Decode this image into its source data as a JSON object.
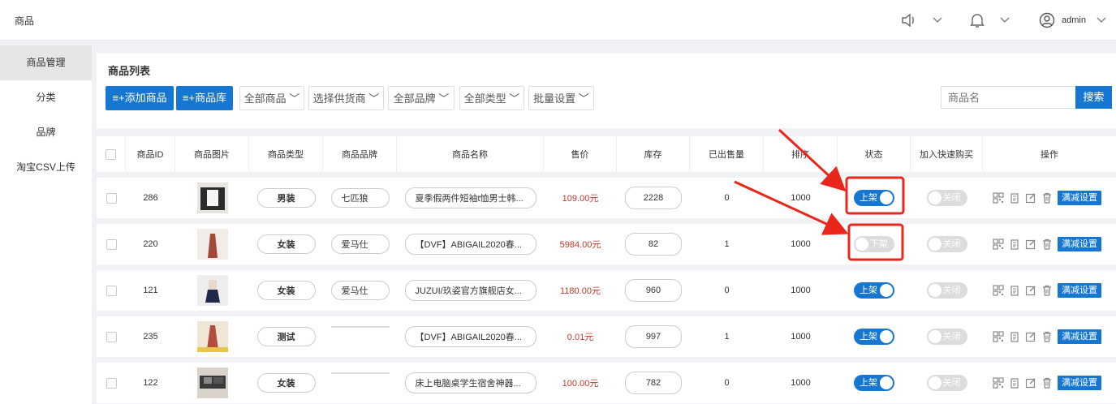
{
  "header": {
    "title": "商品",
    "user": "admin"
  },
  "sidebar": {
    "items": [
      {
        "label": "商品管理",
        "active": true
      },
      {
        "label": "分类"
      },
      {
        "label": "品牌"
      },
      {
        "label": "淘宝CSV上传"
      }
    ]
  },
  "toolbar": {
    "title": "商品列表",
    "add_button": "添加商品",
    "library_button": "商品库",
    "filters": [
      "全部商品",
      "选择供货商",
      "全部品牌",
      "全部类型",
      "批量设置"
    ],
    "search_placeholder": "商品名",
    "search_button": "搜索"
  },
  "table": {
    "headers": [
      "商品ID",
      "商品图片",
      "商品类型",
      "商品品牌",
      "商品名称",
      "售价",
      "库存",
      "已出售量",
      "排序",
      "状态",
      "加入快速购买",
      "操作"
    ],
    "rows": [
      {
        "id": "286",
        "type": "男装",
        "brand": "七匹狼",
        "name": "夏季假两件短袖t恤男士韩...",
        "price": "109.00元",
        "stock": "2228",
        "sold": "0",
        "sort": "1000",
        "status": "上架",
        "status_on": true,
        "quick": "关闭",
        "action": "满减设置",
        "thumb": "dark"
      },
      {
        "id": "220",
        "type": "女装",
        "brand": "爱马仕",
        "name": "【DVF】ABIGAIL2020春...",
        "price": "5984.00元",
        "stock": "82",
        "sold": "1",
        "sort": "1000",
        "status": "下架",
        "status_on": false,
        "quick": "关闭",
        "action": "满减设置",
        "thumb": "dress"
      },
      {
        "id": "121",
        "type": "女装",
        "brand": "爱马仕",
        "name": "JUZUI/玖姿官方旗舰店女...",
        "price": "1180.00元",
        "stock": "960",
        "sold": "0",
        "sort": "1000",
        "status": "上架",
        "status_on": true,
        "quick": "关闭",
        "action": "满减设置",
        "thumb": "skirt"
      },
      {
        "id": "235",
        "type": "测试",
        "brand": "",
        "name": "【DVF】ABIGAIL2020春...",
        "price": "0.01元",
        "stock": "997",
        "sold": "1",
        "sort": "1000",
        "status": "上架",
        "status_on": true,
        "quick": "关闭",
        "action": "满减设置",
        "thumb": "dress2"
      },
      {
        "id": "122",
        "type": "女装",
        "brand": "",
        "name": "床上电脑桌学生宿舍神器...",
        "price": "100.00元",
        "stock": "782",
        "sold": "0",
        "sort": "1000",
        "status": "上架",
        "status_on": true,
        "quick": "关闭",
        "action": "满减设置",
        "thumb": "desk"
      }
    ]
  },
  "colors": {
    "primary": "#1677d2",
    "price": "#c0392b",
    "annotation": "#e8261c"
  }
}
